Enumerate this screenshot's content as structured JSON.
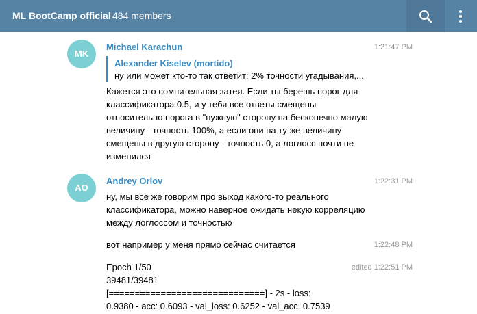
{
  "header": {
    "title": "ML BootCamp official",
    "members": "484 members",
    "search_icon": "search-icon",
    "more_icon": "more-vertical-icon"
  },
  "messages": [
    {
      "avatar_initials": "MK",
      "author": "Michael Karachun",
      "time": "1:21:47 PM",
      "reply": {
        "author": "Alexander Kiselev (mortido)",
        "text": "ну или может кто-то так ответит: 2% точности угадывания,..."
      },
      "lines": [
        "Кажется это сомнительная затея. Если ты берешь порог для",
        "классификатора 0.5, и у тебя все ответы смещены",
        "относительно порога в \"нужную\" сторону на бесконечно малую",
        "величину - точность 100%, а если они на ту же величину",
        "смещены в другую сторону - точность 0, а логлосс почти не",
        "изменился"
      ]
    },
    {
      "avatar_initials": "AO",
      "author": "Andrey Orlov",
      "time": "1:22:31 PM",
      "lines": [
        "ну, мы все же говорим про выход какого-то реального",
        "классификатора, можно наверное ожидать некую корреляцию",
        "между логлоссом и точностью"
      ]
    },
    {
      "time": "1:22:48 PM",
      "lines": [
        "вот например у меня прямо сейчас считается"
      ]
    },
    {
      "time": "edited 1:22:51 PM",
      "lines": [
        "Epoch 1/50",
        "39481/39481",
        "[==============================] - 2s - loss:",
        "0.9380 - acc: 0.6093 - val_loss: 0.6252 - val_acc: 0.7539"
      ]
    }
  ],
  "colors": {
    "header": "#5682a3",
    "author": "#3a8bbf",
    "avatar": "#7cd0d4"
  }
}
